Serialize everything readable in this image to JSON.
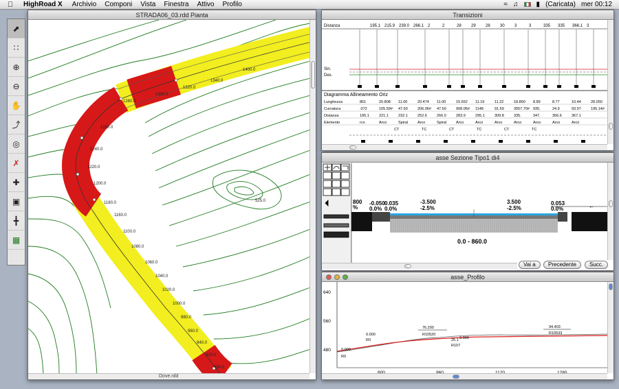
{
  "menubar": {
    "app_name": "HighRoad X",
    "items": [
      "Archivio",
      "Componi",
      "Vista",
      "Finestra",
      "Attivo",
      "Profilo"
    ],
    "battery": "(Caricata)",
    "clock": "mer 00:12"
  },
  "plan_window": {
    "title": "STRADA06_03.rdd Pianta",
    "labels": [
      "1400.0",
      "1340.0",
      "1320.0",
      "1300.0",
      "1280.0",
      "1260.0",
      "1240.0",
      "1220.0",
      "1200.0",
      "1180.0",
      "1160.0",
      "1100.0",
      "1080.0",
      "1060.0",
      "1040.0",
      "1020.0",
      "1000.0",
      "980.0",
      "960.0",
      "940.0",
      "920.0",
      "900.0",
      "525.0"
    ],
    "bottom_scroll_text": "Dove.rdd"
  },
  "tools": [
    "arrow-tool-icon",
    "points-tool-icon",
    "zoom-in-icon",
    "zoom-out-icon",
    "hand-icon",
    "node-edit-icon",
    "target-icon",
    "delete-target-icon",
    "crosshair-icon",
    "frame-icon",
    "section-icon",
    "grid-icon"
  ],
  "transitions_window": {
    "title": "Transizioni",
    "top_row_label": "Distanza",
    "top_row_values": [
      "195.1",
      "215.9",
      "239.0",
      "266.1",
      "2",
      "2",
      "28",
      "29",
      "28",
      "30",
      "3",
      "3",
      "335",
      "335",
      "366.1",
      "3"
    ],
    "sin_label": "Sin.",
    "dex_label": "Dex.",
    "diagram_title": "Diagramma Allineamento Oriz",
    "rows": [
      {
        "label": "Lunghezza",
        "values": [
          "861",
          "20.808",
          "11.00",
          "20.474",
          "11.00",
          "15.652",
          "11.19",
          "11.22",
          "18.860",
          "8.89",
          "8.77",
          "10.44",
          "28.050"
        ]
      },
      {
        "label": "Curvatura",
        "values": [
          ".072",
          "105.59#",
          "47.60",
          "206.06#",
          "47.60",
          "908.06#",
          "1148",
          "91.69",
          "3057.70#",
          "935.",
          "24.9",
          "93.97",
          "195.14#"
        ]
      },
      {
        "label": "Distanza",
        "values": [
          "195.1",
          "221.1",
          "232.1",
          "252.6",
          "266.0",
          "283.9",
          "295.1",
          "309.8",
          "335.",
          "347.",
          "356.6",
          "367.1"
        ]
      },
      {
        "label": "Elemento",
        "values": [
          "rco",
          "Arco",
          "Spiral",
          "Arco",
          "Spiral",
          "Arco",
          "Arco",
          "Arco",
          "Arco",
          "Arco",
          "Arco",
          "Arco"
        ]
      }
    ],
    "element_codes": [
      "CT",
      "TC",
      "CT",
      "TC",
      "CT",
      "TC"
    ]
  },
  "section_window": {
    "title": "asse  Sezione Tipo1 di4",
    "left_label_top": "800",
    "left_label_pct": "%",
    "labels": [
      {
        "top": "-0.050",
        "bot": "0.0%"
      },
      {
        "top": "0.035",
        "bot": "0.0%"
      },
      {
        "top": "-3.500",
        "bot": "-2.5%"
      },
      {
        "top": "3.500",
        "bot": "-2.5%"
      },
      {
        "top": "0.053",
        "bot": "0.0%"
      }
    ],
    "range_label": "0.0 - 860.0",
    "buttons": {
      "goto": "Vai a",
      "prev": "Precedente",
      "next": "Succ."
    }
  },
  "profile_window": {
    "title": "asse_Profilo",
    "y_ticks": [
      "640",
      "560",
      "480"
    ],
    "x_ticks": [
      "800",
      "960",
      "1120",
      "1280"
    ],
    "annotations": [
      {
        "a": "0.000",
        "b": "R0"
      },
      {
        "a": "0.000",
        "b": "R0"
      },
      {
        "a": "76.200",
        "b": "R10520"
      },
      {
        "a": "25.1",
        "b": "R107"
      },
      {
        "a": "0.000",
        "b": ""
      },
      {
        "a": "94.403",
        "b": "R10533"
      }
    ]
  },
  "colors": {
    "road_yellow": "#f2ee1f",
    "curve_red": "#d71818",
    "contour_green": "#1d7a1d",
    "profile_red": "#d81c1c",
    "section_blue": "#2aa6e0"
  }
}
